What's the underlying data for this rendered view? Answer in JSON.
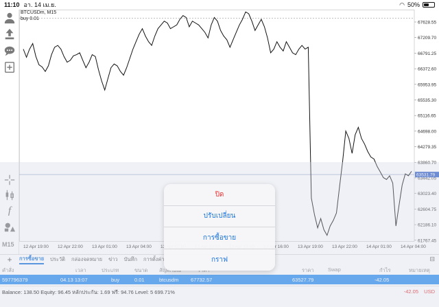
{
  "status_bar": {
    "time": "11:10",
    "date": "อา. 14 เม.ย.",
    "battery": "50%"
  },
  "chart": {
    "symbol_label": "BTCUSDm, M15",
    "order_label": "buy 0.01",
    "timeframe": "M15",
    "current_price": "63531.79",
    "line_color": "#111111",
    "current_price_color": "#3a64c8"
  },
  "chart_data": {
    "type": "line",
    "title": "",
    "xlabel": "",
    "ylabel": "",
    "y_ticks": [
      "67628.55",
      "67209.70",
      "66791.25",
      "66372.60",
      "65953.95",
      "65535.30",
      "65116.65",
      "64698.00",
      "64279.35",
      "63860.70",
      "63442.05",
      "63023.40",
      "62604.75",
      "62186.10",
      "61767.45"
    ],
    "x_ticks": [
      "12 Apr 19:00",
      "12 Apr 22:00",
      "13 Apr 01:00",
      "13 Apr 04:00",
      "13 Apr 07:00",
      "13 Apr 10:00",
      "13 Apr 13:00",
      "13 Apr 16:00",
      "13 Apr 19:00",
      "13 Apr 22:00",
      "14 Apr 01:00",
      "14 Apr 04:00"
    ],
    "ylim": [
      61550,
      67900
    ],
    "current_price": 63531.79,
    "values": [
      66900,
      66680,
      66900,
      67050,
      66700,
      66480,
      66420,
      66300,
      66450,
      66750,
      66950,
      67000,
      66900,
      66700,
      66550,
      66600,
      66720,
      66750,
      66800,
      66600,
      66400,
      66550,
      66750,
      66700,
      66350,
      66050,
      65800,
      66100,
      66400,
      66500,
      66450,
      66300,
      66200,
      66400,
      66650,
      66900,
      67100,
      67300,
      67450,
      67250,
      67100,
      67000,
      67250,
      67450,
      67550,
      67650,
      67600,
      67450,
      67500,
      67550,
      67700,
      67800,
      67750,
      67500,
      67650,
      67600,
      67550,
      67450,
      67350,
      67200,
      67550,
      67750,
      67650,
      67400,
      67250,
      67150,
      66950,
      67150,
      67350,
      67550,
      67700,
      67900,
      67850,
      67650,
      67400,
      67550,
      67700,
      67500,
      67200,
      66800,
      66900,
      67100,
      66950,
      66850,
      67100,
      66950,
      66800,
      66750,
      66900,
      67000,
      66900,
      66950,
      62900,
      62450,
      62100,
      62350,
      62050,
      61900,
      62150,
      62300,
      62500,
      63200,
      63900,
      64700,
      64500,
      64100,
      64600,
      64800,
      64500,
      64350,
      64150,
      64000,
      63950,
      63750,
      63600,
      63450,
      63400,
      63500,
      63300,
      62150,
      62700,
      63250,
      63550,
      63500,
      63620
    ],
    "series": [
      {
        "values_ref": "values"
      }
    ]
  },
  "tabs": {
    "items": [
      "การซื้อขาย",
      "ประวัติ",
      "กล่องจดหมาย",
      "ข่าว",
      "บันทึก",
      "การตั้งค่า"
    ],
    "active": 0
  },
  "table": {
    "headers": [
      "คำสั่ง",
      "เวลา",
      "ประเภท",
      "ขนาด",
      "สัญลักษณ์",
      "ราคา",
      "ราคา",
      "Swap",
      "กำไร",
      "หมายเหตุ"
    ],
    "row": {
      "order": "597796379",
      "time": "04.13 13:07",
      "type": "buy",
      "volume": "0.01",
      "symbol": "btcusdm",
      "open_price": "67732.57",
      "price": "63527.79",
      "profit": "-42.05"
    }
  },
  "balance": {
    "text": "Balance: 138.50 Equity: 96.45 หลักประกัน: 1.69 ฟรี: 94.76 Level: 5 699.71%",
    "total": "-42.05",
    "currency": "USD"
  },
  "action_sheet": {
    "items": [
      {
        "label": "ปิด",
        "style": "danger"
      },
      {
        "label": "ปรับเปลี่ยน",
        "style": "default"
      },
      {
        "label": "การซื้อขาย",
        "style": "default"
      },
      {
        "label": "กราฟ",
        "style": "default"
      }
    ]
  }
}
